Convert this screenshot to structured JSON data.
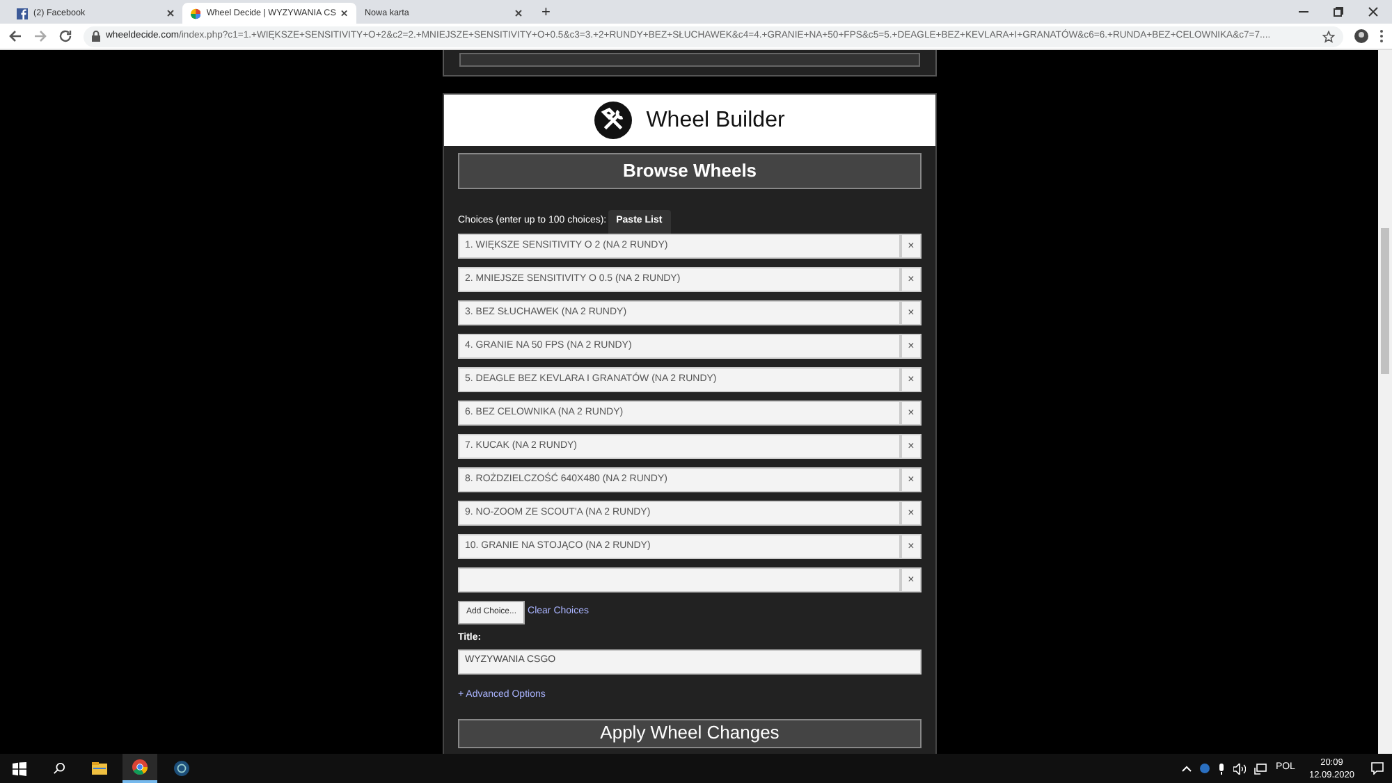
{
  "browser": {
    "tabs": [
      {
        "title": "(2) Facebook",
        "kind": "facebook",
        "selected": false
      },
      {
        "title": "Wheel Decide | WYZYWANIA CS",
        "kind": "wheel",
        "selected": true
      },
      {
        "title": "Nowa karta",
        "kind": "blank",
        "selected": false
      }
    ],
    "new_tab": "+",
    "url_host": "wheeldecide.com",
    "url_path": "/index.php?c1=1.+WIĘKSZE+SENSITIVITY+O+2&c2=2.+MNIEJSZE+SENSITIVITY+O+0.5&c3=3.+2+RUNDY+BEZ+SŁUCHAWEK&c4=4.+GRANIE+NA+50+FPS&c5=5.+DEAGLE+BEZ+KEVLARA+I+GRANATÓW&c6=6.+RUNDA+BEZ+CELOWNIKA&c7=7...."
  },
  "builder": {
    "title": "Wheel Builder",
    "browse_button": "Browse Wheels",
    "choices_label": "Choices (enter up to 100 choices):",
    "paste_button": "Paste List",
    "choices": [
      {
        "value": "1. WIĘKSZE SENSITIVITY O 2 (NA 2 RUNDY)",
        "remove": "×"
      },
      {
        "value": "2. MNIEJSZE SENSITIVITY O 0.5 (NA 2 RUNDY)",
        "remove": "×"
      },
      {
        "value": "3. BEZ SŁUCHAWEK  (NA 2 RUNDY)",
        "remove": "×"
      },
      {
        "value": "4. GRANIE NA 50 FPS (NA 2 RUNDY)",
        "remove": "×"
      },
      {
        "value": "5. DEAGLE BEZ KEVLARA I GRANATÓW (NA 2 RUNDY)",
        "remove": "×"
      },
      {
        "value": "6. BEZ CELOWNIKA (NA 2 RUNDY)",
        "remove": "×"
      },
      {
        "value": "7. KUCAK (NA 2 RUNDY)",
        "remove": "×"
      },
      {
        "value": "8. ROŻDZIELCZOŚĆ 640X480 (NA 2 RUNDY)",
        "remove": "×"
      },
      {
        "value": "9. NO-ZOOM ZE SCOUT'A (NA 2 RUNDY)",
        "remove": "×"
      },
      {
        "value": "10. GRANIE NA STOJĄCO (NA 2 RUNDY)",
        "remove": "×"
      },
      {
        "remove": "×"
      }
    ],
    "add_button": "Add Choice...",
    "clear_link": "Clear Choices",
    "title_label": "Title:",
    "title_value": "WYZYWANIA CSGO",
    "advanced_link": "+ Advanced Options",
    "apply_button": "Apply Wheel Changes"
  },
  "taskbar": {
    "tray_language": "POL",
    "time": "20:09",
    "date": "12.09.2020"
  }
}
